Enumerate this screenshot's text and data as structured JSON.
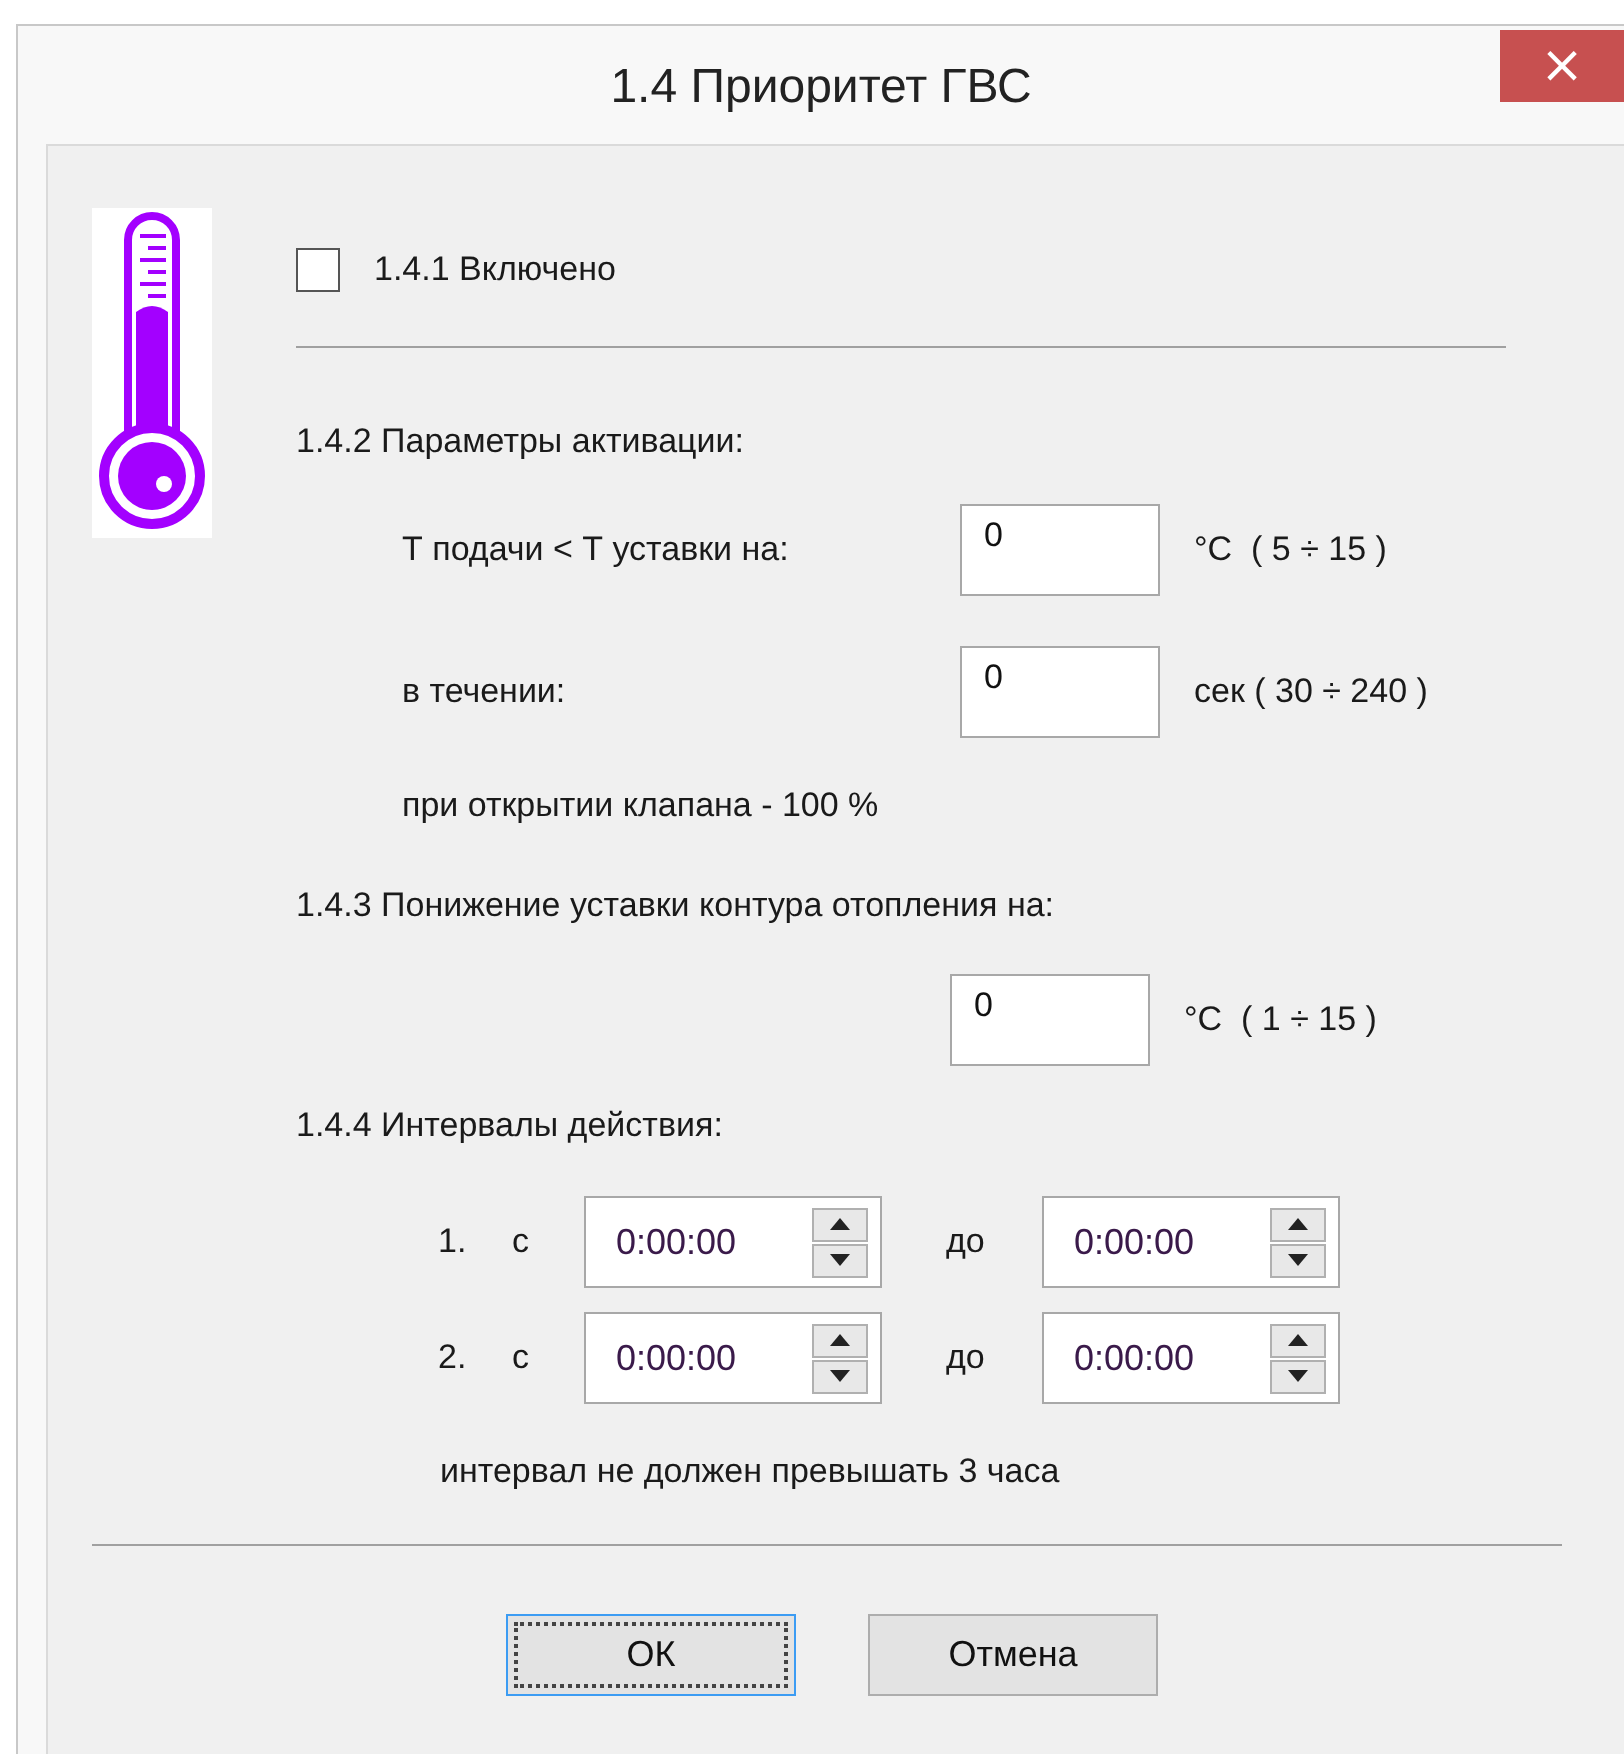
{
  "window": {
    "title": "1.4 Приоритет ГВС",
    "close": "×"
  },
  "enabled": {
    "label": "1.4.1 Включено",
    "checked": false
  },
  "activation": {
    "heading": "1.4.2 Параметры активации:",
    "fields": [
      {
        "label": "Т подачи < Т уставки на:",
        "value": "0",
        "unit": "°С  ( 5 ÷ 15 )"
      },
      {
        "label": "в течении:",
        "value": "0",
        "unit": "сек ( 30 ÷ 240 )"
      }
    ],
    "note": "при открытии клапана - 100 %"
  },
  "reduction": {
    "heading": "1.4.3 Понижение уставки контура отопления на:",
    "value": "0",
    "unit": "°С  ( 1 ÷ 15 )"
  },
  "intervals": {
    "heading": "1.4.4 Интервалы действия:",
    "rows": [
      {
        "number": "1.",
        "from_label": "с",
        "from": "0:00:00",
        "to_label": "до",
        "to": "0:00:00"
      },
      {
        "number": "2.",
        "from_label": "с",
        "from": "0:00:00",
        "to_label": "до",
        "to": "0:00:00"
      }
    ],
    "note": "интервал не должен превышать 3 часа"
  },
  "buttons": [
    {
      "label": "ОК",
      "focused": true
    },
    {
      "label": "Отмена",
      "focused": false
    }
  ]
}
